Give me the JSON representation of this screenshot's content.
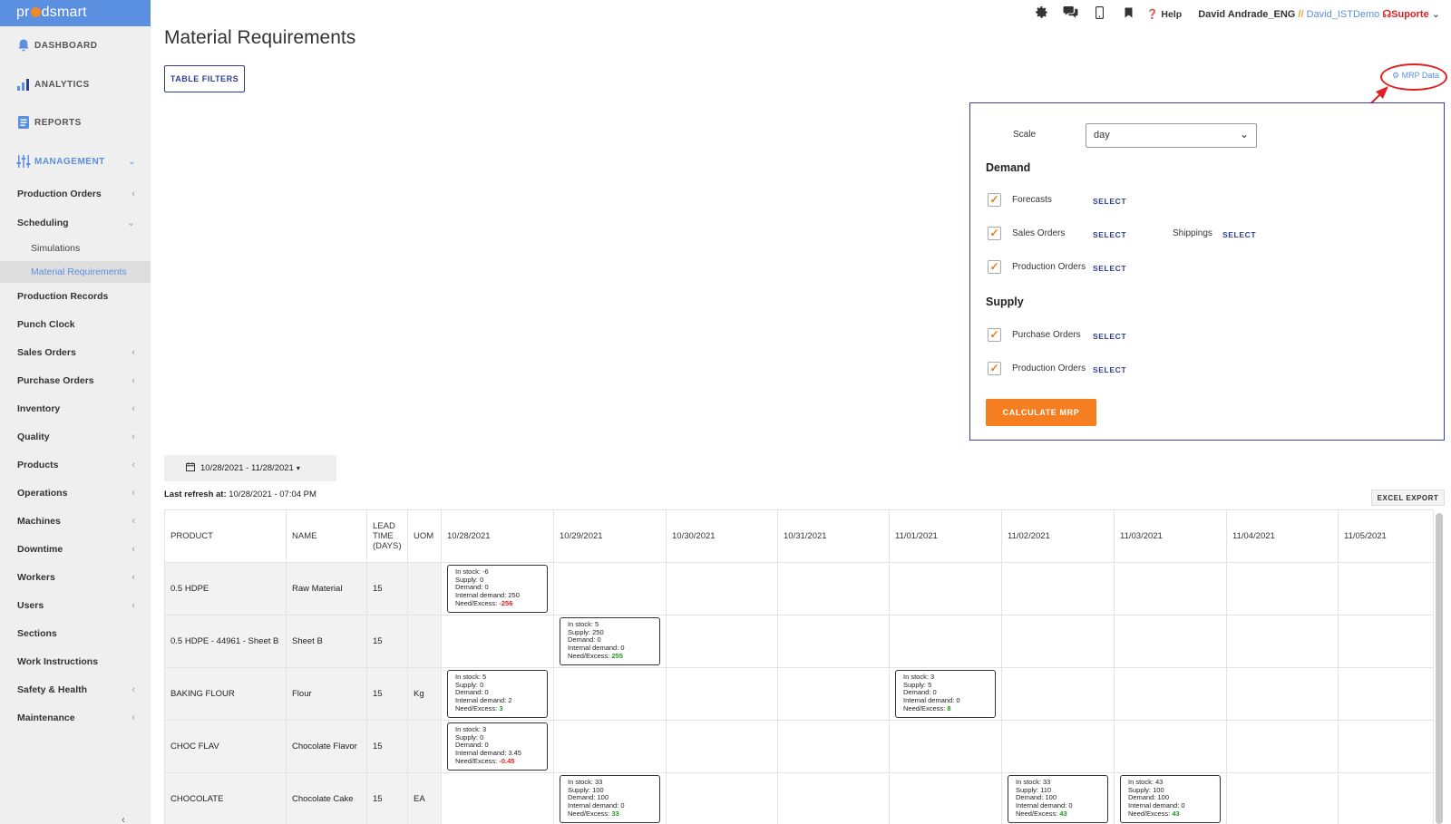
{
  "app": {
    "logo_pre": "pr",
    "logo_post": "dsmart"
  },
  "sidebar": {
    "main": [
      {
        "label": "DASHBOARD",
        "icon": "bell-icon"
      },
      {
        "label": "ANALYTICS",
        "icon": "bar-chart-icon"
      },
      {
        "label": "REPORTS",
        "icon": "report-icon"
      },
      {
        "label": "MANAGEMENT",
        "icon": "sliders-icon"
      }
    ],
    "items": [
      {
        "label": "Production Orders",
        "chevron": "‹"
      },
      {
        "label": "Scheduling",
        "chevron": "⌄"
      },
      {
        "label": "Production Records",
        "chevron": ""
      },
      {
        "label": "Punch Clock",
        "chevron": ""
      },
      {
        "label": "Sales Orders",
        "chevron": "‹"
      },
      {
        "label": "Purchase Orders",
        "chevron": "‹"
      },
      {
        "label": "Inventory",
        "chevron": "‹"
      },
      {
        "label": "Quality",
        "chevron": "‹"
      },
      {
        "label": "Products",
        "chevron": "‹"
      },
      {
        "label": "Operations",
        "chevron": "‹"
      },
      {
        "label": "Machines",
        "chevron": "‹"
      },
      {
        "label": "Downtime",
        "chevron": "‹"
      },
      {
        "label": "Workers",
        "chevron": "‹"
      },
      {
        "label": "Users",
        "chevron": "‹"
      },
      {
        "label": "Sections",
        "chevron": ""
      },
      {
        "label": "Work Instructions",
        "chevron": ""
      },
      {
        "label": "Safety & Health",
        "chevron": "‹"
      },
      {
        "label": "Maintenance",
        "chevron": "‹"
      }
    ],
    "sub": [
      {
        "label": "Simulations"
      },
      {
        "label": "Material Requirements"
      }
    ],
    "collapse_glyph": "‹"
  },
  "topbar": {
    "help": "Help",
    "user": "David Andrade_ENG",
    "sep": " //",
    "demo": " David_ISTDemo",
    "support": "Suporte"
  },
  "page": {
    "title": "Material Requirements",
    "table_filters": "TABLE FILTERS",
    "mrp_link": "MRP Data"
  },
  "mrp_panel": {
    "scale_label": "Scale",
    "scale_value": "day",
    "demand_heading": "Demand",
    "supply_heading": "Supply",
    "select": "SELECT",
    "forecasts": "Forecasts",
    "sales_orders": "Sales Orders",
    "shippings": "Shippings",
    "production_orders": "Production Orders",
    "purchase_orders": "Purchase Orders",
    "calculate": "CALCULATE MRP"
  },
  "daterange": "10/28/2021 - 11/28/2021",
  "refresh": {
    "label": "Last refresh at:",
    "value": " 10/28/2021 - 07:04 PM"
  },
  "excel_export": "EXCEL EXPORT",
  "table": {
    "headers": [
      "PRODUCT",
      "NAME",
      "LEAD TIME (DAYS)",
      "UOM",
      "10/28/2021",
      "10/29/2021",
      "10/30/2021",
      "10/31/2021",
      "11/01/2021",
      "11/02/2021",
      "11/03/2021",
      "11/04/2021",
      "11/05/2021"
    ],
    "rows": [
      {
        "product": "0.5 HDPE",
        "name": "Raw Material",
        "lead": "15",
        "uom": "",
        "cells": [
          {
            "stock": "In stock: -6",
            "supply": "Supply: 0",
            "demand": "Demand: 0",
            "internal": "Internal demand: 250",
            "need_label": "Need/Excess: ",
            "need": "-256",
            "sign": "neg"
          },
          null,
          null,
          null,
          null,
          null,
          null,
          null,
          null
        ]
      },
      {
        "product": "0.5 HDPE - 44961 - Sheet B",
        "name": "Sheet B",
        "lead": "15",
        "uom": "",
        "cells": [
          null,
          {
            "stock": "In stock: 5",
            "supply": "Supply: 250",
            "demand": "Demand: 0",
            "internal": "Internal demand: 0",
            "need_label": "Need/Excess: ",
            "need": "255",
            "sign": "pos"
          },
          null,
          null,
          null,
          null,
          null,
          null,
          null
        ]
      },
      {
        "product": "BAKING FLOUR",
        "name": "Flour",
        "lead": "15",
        "uom": "Kg",
        "cells": [
          {
            "stock": "In stock: 5",
            "supply": "Supply: 0",
            "demand": "Demand: 0",
            "internal": "Internal demand: 2",
            "need_label": "Need/Excess: ",
            "need": "3",
            "sign": "pos"
          },
          null,
          null,
          null,
          {
            "stock": "In stock: 3",
            "supply": "Supply: 5",
            "demand": "Demand: 0",
            "internal": "Internal demand: 0",
            "need_label": "Need/Excess: ",
            "need": "8",
            "sign": "pos"
          },
          null,
          null,
          null,
          null
        ]
      },
      {
        "product": "CHOC FLAV",
        "name": "Chocolate Flavor",
        "lead": "15",
        "uom": "",
        "cells": [
          {
            "stock": "In stock: 3",
            "supply": "Supply: 0",
            "demand": "Demand: 0",
            "internal": "Internal demand: 3.45",
            "need_label": "Need/Excess: ",
            "need": "-0.45",
            "sign": "neg"
          },
          null,
          null,
          null,
          null,
          null,
          null,
          null,
          null
        ]
      },
      {
        "product": "CHOCOLATE",
        "name": "Chocolate Cake",
        "lead": "15",
        "uom": "EA",
        "cells": [
          null,
          {
            "stock": "In stock: 33",
            "supply": "Supply: 100",
            "demand": "Demand: 100",
            "internal": "Internal demand: 0",
            "need_label": "Need/Excess: ",
            "need": "33",
            "sign": "pos"
          },
          null,
          null,
          null,
          {
            "stock": "In stock: 33",
            "supply": "Supply: 110",
            "demand": "Demand: 100",
            "internal": "Internal demand: 0",
            "need_label": "Need/Excess: ",
            "need": "43",
            "sign": "pos"
          },
          {
            "stock": "In stock: 43",
            "supply": "Supply: 100",
            "demand": "Demand: 100",
            "internal": "Internal demand: 0",
            "need_label": "Need/Excess: ",
            "need": "43",
            "sign": "pos"
          },
          null,
          null
        ]
      }
    ]
  },
  "colors": {
    "accent": "#5b8fe0",
    "navy": "#2c3e8f",
    "orange": "#f57f20",
    "red": "#e02020",
    "green": "#1a9a1a"
  }
}
